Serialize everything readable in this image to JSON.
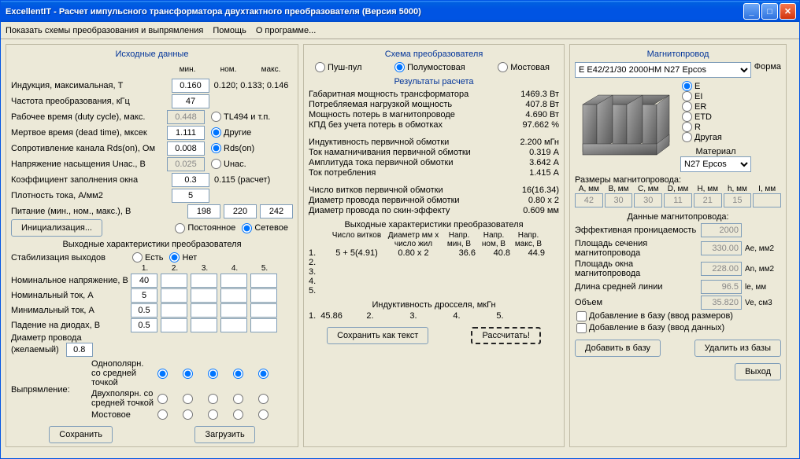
{
  "window": {
    "title": "ExcellentIT - Расчет импульсного трансформатора двухтактного преобразователя (Версия 5000)"
  },
  "menu": {
    "m1": "Показать схемы преобразования и выпрямления",
    "m2": "Помощь",
    "m3": "О программе..."
  },
  "col1": {
    "title": "Исходные данные",
    "hmin": "мин.",
    "hnom": "ном.",
    "hmax": "макс.",
    "r1": "Индукция, максимальная, Т",
    "v1": "0.160",
    "v1r": "0.120; 0.133; 0.146",
    "r2": "Частота преобразования, кГц",
    "v2": "47",
    "r3": "Рабочее время (duty cycle), макс.",
    "v3": "0.448",
    "r3opt": "TL494 и т.п.",
    "r4": "Мертвое время (dead time), мксек",
    "v4": "1.111",
    "r4opt": "Другие",
    "r5": "Сопротивление канала Rds(on), Ом",
    "v5": "0.008",
    "r5opt": "Rds(on)",
    "r6": "Напряжение насыщения Uнас., В",
    "v6": "0.025",
    "r6opt": "Uнас.",
    "r7": "Коэффициент заполнения окна",
    "v7": "0.3",
    "v7r": "0.115 (расчет)",
    "r8": "Плотность тока, А/мм2",
    "v8": "5",
    "r9": "Питание (мин., ном., макс.), В",
    "v9a": "198",
    "v9b": "220",
    "v9c": "242",
    "btn_init": "Инициализация...",
    "pwr_dc": "Постоянное",
    "pwr_ac": "Сетевое",
    "out_title": "Выходные характеристики преобразователя",
    "stab_lbl": "Стабилизация выходов",
    "stab_yes": "Есть",
    "stab_no": "Нет",
    "c1": "1.",
    "c2": "2.",
    "c3": "3.",
    "c4": "4.",
    "c5": "5.",
    "or1": "Номинальное напряжение, В",
    "ov1": "40",
    "or2": "Номинальный ток, А",
    "ov2": "5",
    "or3": "Минимальный ток, А",
    "ov3": "0.5",
    "or4": "Падение на диодах, В",
    "ov4": "0.5",
    "wire_lbl": "Диаметр провода (желаемый)",
    "wire_v": "0.8",
    "rect_lbl": "Выпрямление:",
    "rect1": "Однополярн. со средней точкой",
    "rect2": "Двухполярн. со средней точкой",
    "rect3": "Мостовое",
    "btn_save": "Сохранить",
    "btn_load": "Загрузить"
  },
  "col2": {
    "title": "Схема преобразователя",
    "s1": "Пуш-пул",
    "s2": "Полумостовая",
    "s3": "Мостовая",
    "res_title": "Результаты расчета",
    "rr1": "Габаритная мощность трансформатора",
    "rv1": "1469.3 Вт",
    "rr2": "Потребляемая нагрузкой мощность",
    "rv2": "407.8 Вт",
    "rr3": "Мощность потерь в магнитопроводе",
    "rv3": "4.690 Вт",
    "rr4": "КПД без учета потерь в обмотках",
    "rv4": "97.662 %",
    "rr5": "Индуктивность первичной обмотки",
    "rv5": "2.200 мГн",
    "rr6": "Ток намагничивания первичной обмотки",
    "rv6": "0.319 А",
    "rr7": "Амплитуда тока первичной обмотки",
    "rv7": "3.642 А",
    "rr8": "Ток потребления",
    "rv8": "1.415 А",
    "rr9": "Число витков первичной обмотки",
    "rv9": "16(16.34)",
    "rr10": "Диаметр провода первичной обмотки",
    "rv10": "0.80 x 2",
    "rr11": "Диаметр провода по скин-эффекту",
    "rv11": "0.609 мм",
    "sec_title": "Выходные характеристики преобразователя",
    "sh1": "Число витков",
    "sh2": "Диаметр мм x число жил",
    "sh3": "Напр. мин, В",
    "sh4": "Напр. ном, В",
    "sh5": "Напр. макс, В",
    "s1n": "1.",
    "s1a": "5 + 5(4.91)",
    "s1b": "0.80 x 2",
    "s1c": "36.6",
    "s1d": "40.8",
    "s1e": "44.9",
    "s2n": "2.",
    "s3n": "3.",
    "s4n": "4.",
    "s5n": "5.",
    "ind_title": "Индуктивность дросселя, мкГн",
    "ind_row": "1.  45.86          2.               3.               4.               5.",
    "btn_savetxt": "Сохранить как текст",
    "btn_calc": "Рассчитать!"
  },
  "col3": {
    "title": "Магнитопровод",
    "core_sel": "E E42/21/30 2000HM N27 Epcos",
    "shape_lbl": "Форма",
    "sh_E": "E",
    "sh_EI": "EI",
    "sh_ER": "ER",
    "sh_ETD": "ETD",
    "sh_R": "R",
    "sh_OTHER": "Другая",
    "mat_lbl": "Материал",
    "mat_sel": "N27 Epcos",
    "dims_title": "Размеры магнитопровода:",
    "dA": "A, мм",
    "dB": "B, мм",
    "dC": "C, мм",
    "dD": "D, мм",
    "dH": "H, мм",
    "dh": "h, мм",
    "dI": "I, мм",
    "vA": "42",
    "vB": "30",
    "vC": "30",
    "vD": "11",
    "vH": "21",
    "vh": "15",
    "vI": "",
    "data_title": "Данные магнитопровода:",
    "m1": "Эффективная проницаемость",
    "m1v": "2000",
    "m2": "Площадь сечения магнитопровода",
    "m2v": "330.00",
    "m2u": "Ae, мм2",
    "m3": "Площадь окна магнитопровода",
    "m3v": "228.00",
    "m3u": "An, мм2",
    "m4": "Длина средней линии",
    "m4v": "96.5",
    "m4u": "le, мм",
    "m5": "Объем",
    "m5v": "35.820",
    "m5u": "Ve, см3",
    "chk1": "Добавление в базу (ввод размеров)",
    "chk2": "Добавление в базу (ввод данных)",
    "btn_add": "Добавить в базу",
    "btn_del": "Удалить из базы",
    "btn_exit": "Выход"
  }
}
